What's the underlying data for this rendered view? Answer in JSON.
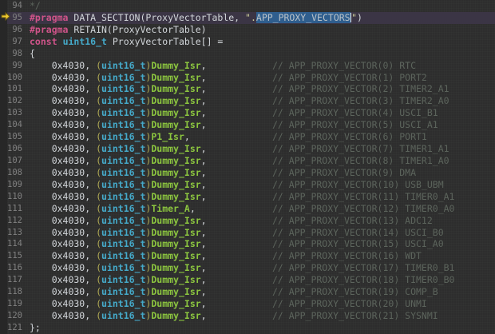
{
  "colors": {
    "bg": "#2d2d2d",
    "gutter_bar": "#272727",
    "line_highlight": "#3b3545",
    "line_number": "#818181",
    "default_text": "#d2d6da",
    "keyword": "#d0548a",
    "type": "#45a9c9",
    "handler": "#8cc63f",
    "paren": "#b1ab54",
    "string": "#cfcf9a",
    "comment": "#5c645c",
    "selection_bg": "#2f5e8e",
    "selection_text": "#bac3c9",
    "cursor": "#f0f0f0",
    "arrow_fill": "#edc930",
    "arrow_stroke": "#6e5c12"
  },
  "editor": {
    "marker_icon": "instruction-pointer-arrow",
    "selected_text": "APP_PROXY_VECTORS"
  },
  "code": {
    "lines": [
      {
        "n": "94",
        "segs": [
          {
            "t": "*/",
            "c": "comment"
          }
        ]
      },
      {
        "n": "95",
        "current": true,
        "marker": true,
        "segs": [
          {
            "t": "#pragma",
            "c": "keyword"
          },
          {
            "t": " DATA_SECTION(ProxyVectorTable, ",
            "c": "default"
          },
          {
            "t": "\".",
            "c": "string"
          },
          {
            "t": "APP_PROXY_VECTORS",
            "c": "selected"
          },
          {
            "cursor": true
          },
          {
            "t": "\"",
            "c": "string"
          },
          {
            "t": ")",
            "c": "default"
          }
        ]
      },
      {
        "n": "96",
        "segs": [
          {
            "t": "#pragma",
            "c": "keyword"
          },
          {
            "t": " RETAIN(ProxyVectorTable)",
            "c": "default"
          }
        ]
      },
      {
        "n": "97",
        "segs": [
          {
            "t": "const",
            "c": "keyword"
          },
          {
            "t": " ",
            "c": "default"
          },
          {
            "t": "uint16_t",
            "c": "type"
          },
          {
            "t": " ProxyVectorTable[] =",
            "c": "default"
          }
        ]
      },
      {
        "n": "98",
        "segs": [
          {
            "t": "{",
            "c": "default"
          }
        ]
      },
      {
        "n": "99",
        "vector": {
          "handler": "Dummy_Isr",
          "comment": "// APP_PROXY_VECTOR(0) RTC"
        }
      },
      {
        "n": "100",
        "vector": {
          "handler": "Dummy_Isr",
          "comment": "// APP_PROXY_VECTOR(1) PORT2"
        }
      },
      {
        "n": "101",
        "vector": {
          "handler": "Dummy_Isr",
          "comment": "// APP_PROXY_VECTOR(2) TIMER2_A1"
        }
      },
      {
        "n": "102",
        "vector": {
          "handler": "Dummy_Isr",
          "comment": "// APP_PROXY_VECTOR(3) TIMER2_A0"
        }
      },
      {
        "n": "103",
        "vector": {
          "handler": "Dummy_Isr",
          "comment": "// APP_PROXY_VECTOR(4) USCI_B1"
        }
      },
      {
        "n": "104",
        "vector": {
          "handler": "Dummy_Isr",
          "comment": "// APP_PROXY_VECTOR(5) USCI_A1"
        }
      },
      {
        "n": "105",
        "vector": {
          "handler": "P1_Isr",
          "comment": "// APP_PROXY_VECTOR(6) PORT1"
        }
      },
      {
        "n": "106",
        "vector": {
          "handler": "Dummy_Isr",
          "comment": "// APP_PROXY_VECTOR(7) TIMER1_A1"
        }
      },
      {
        "n": "107",
        "vector": {
          "handler": "Dummy_Isr",
          "comment": "// APP_PROXY_VECTOR(8) TIMER1_A0"
        }
      },
      {
        "n": "108",
        "vector": {
          "handler": "Dummy_Isr",
          "comment": "// APP_PROXY_VECTOR(9) DMA"
        }
      },
      {
        "n": "109",
        "vector": {
          "handler": "Dummy_Isr",
          "comment": "// APP_PROXY_VECTOR(10) USB_UBM"
        }
      },
      {
        "n": "110",
        "vector": {
          "handler": "Dummy_Isr",
          "comment": "// APP_PROXY_VECTOR(11) TIMER0_A1"
        }
      },
      {
        "n": "111",
        "vector": {
          "handler": "Timer_A",
          "comment": "// APP_PROXY_VECTOR(12) TIMER0_A0"
        }
      },
      {
        "n": "112",
        "vector": {
          "handler": "Dummy_Isr",
          "comment": "// APP_PROXY_VECTOR(13) ADC12"
        }
      },
      {
        "n": "113",
        "vector": {
          "handler": "Dummy_Isr",
          "comment": "// APP_PROXY_VECTOR(14) USCI_B0"
        }
      },
      {
        "n": "114",
        "vector": {
          "handler": "Dummy_Isr",
          "comment": "// APP_PROXY_VECTOR(15) USCI_A0"
        }
      },
      {
        "n": "115",
        "vector": {
          "handler": "Dummy_Isr",
          "comment": "// APP_PROXY_VECTOR(16) WDT"
        }
      },
      {
        "n": "116",
        "vector": {
          "handler": "Dummy_Isr",
          "comment": "// APP_PROXY_VECTOR(17) TIMER0_B1"
        }
      },
      {
        "n": "117",
        "vector": {
          "handler": "Dummy_Isr",
          "comment": "// APP_PROXY_VECTOR(18) TIMER0_B0"
        }
      },
      {
        "n": "118",
        "vector": {
          "handler": "Dummy_Isr",
          "comment": "// APP_PROXY_VECTOR(19) COMP_B"
        }
      },
      {
        "n": "119",
        "vector": {
          "handler": "Dummy_Isr",
          "comment": "// APP_PROXY_VECTOR(20) UNMI"
        }
      },
      {
        "n": "120",
        "vector": {
          "handler": "Dummy_Isr",
          "comment": "// APP_PROXY_VECTOR(21) SYSNMI"
        }
      },
      {
        "n": "121",
        "segs": [
          {
            "t": "};",
            "c": "default"
          }
        ]
      }
    ],
    "vector_tokens": {
      "indent_addr": "    0x4030, ",
      "open_paren": "(",
      "type": "uint16_t",
      "close_paren": ")",
      "trailing_comma": ","
    }
  }
}
